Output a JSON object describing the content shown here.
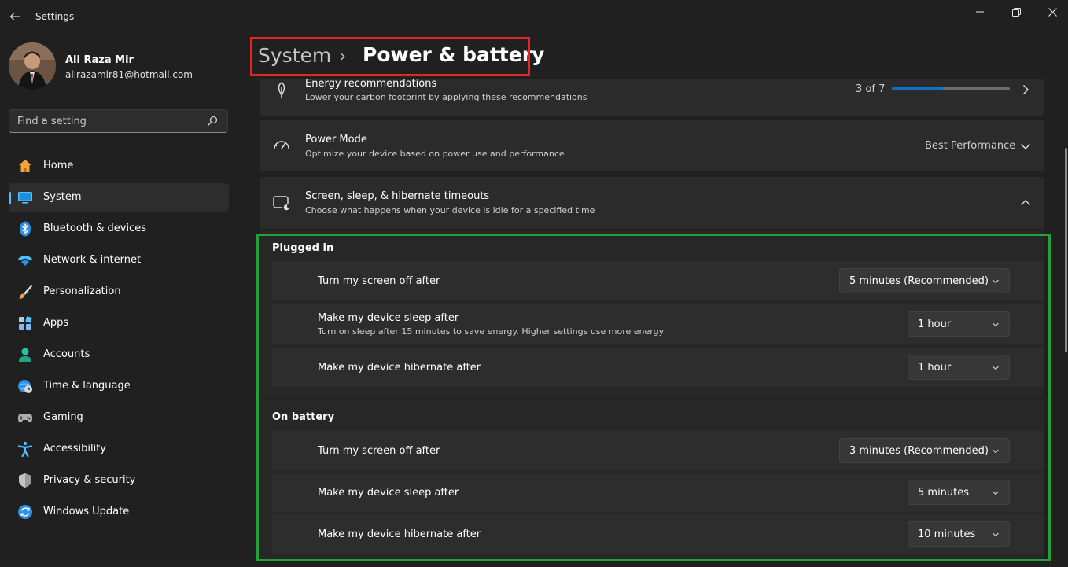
{
  "window": {
    "title": "Settings",
    "back_icon": "back-arrow-icon",
    "controls": [
      "minimize-icon",
      "maximize-icon",
      "close-icon"
    ]
  },
  "user": {
    "name": "Ali Raza Mir",
    "email": "alirazamir81@hotmail.com"
  },
  "search": {
    "placeholder": "Find a setting",
    "icon": "search-icon"
  },
  "nav": {
    "items": [
      {
        "label": "Home",
        "icon": "home-icon",
        "color": "#f3a33c"
      },
      {
        "label": "System",
        "icon": "monitor-icon",
        "color": "#4cc2ff",
        "active": true
      },
      {
        "label": "Bluetooth & devices",
        "icon": "bluetooth-icon",
        "color": "#2f8fe8"
      },
      {
        "label": "Network & internet",
        "icon": "wifi-icon",
        "color": "#4cc2ff"
      },
      {
        "label": "Personalization",
        "icon": "paintbrush-icon",
        "color": "#e8a05a"
      },
      {
        "label": "Apps",
        "icon": "apps-icon",
        "color": "#8ab4f8"
      },
      {
        "label": "Accounts",
        "icon": "person-icon",
        "color": "#27c4a3"
      },
      {
        "label": "Time & language",
        "icon": "globe-clock-icon",
        "color": "#4cc2ff"
      },
      {
        "label": "Gaming",
        "icon": "gamepad-icon",
        "color": "#b0b0b0"
      },
      {
        "label": "Accessibility",
        "icon": "accessibility-icon",
        "color": "#4cc2ff"
      },
      {
        "label": "Privacy & security",
        "icon": "shield-icon",
        "color": "#9a9a9a"
      },
      {
        "label": "Windows Update",
        "icon": "update-icon",
        "color": "#2f8fe8"
      }
    ]
  },
  "breadcrumb": {
    "parent": "System",
    "separator": "›",
    "current": "Power & battery"
  },
  "energy": {
    "title": "Energy recommendations",
    "desc": "Lower your carbon footprint by applying these recommendations",
    "count_text": "3 of 7",
    "progress": 0.43
  },
  "power_mode": {
    "title": "Power Mode",
    "desc": "Optimize your device based on power use and performance",
    "value": "Best Performance"
  },
  "timeouts": {
    "title": "Screen, sleep, & hibernate timeouts",
    "desc": "Choose what happens when your device is idle for a specified time",
    "plugged_in": {
      "label": "Plugged in",
      "rows": [
        {
          "title": "Turn my screen off after",
          "sub": "",
          "value": "5 minutes (Recommended)"
        },
        {
          "title": "Make my device sleep after",
          "sub": "Turn on sleep after 15 minutes to save energy. Higher settings use more energy",
          "value": "1 hour"
        },
        {
          "title": "Make my device hibernate after",
          "sub": "",
          "value": "1 hour"
        }
      ]
    },
    "on_battery": {
      "label": "On battery",
      "rows": [
        {
          "title": "Turn my screen off after",
          "sub": "",
          "value": "3 minutes (Recommended)"
        },
        {
          "title": "Make my device sleep after",
          "sub": "",
          "value": "5 minutes"
        },
        {
          "title": "Make my device hibernate after",
          "sub": "",
          "value": "10 minutes"
        }
      ]
    }
  },
  "colors": {
    "accent": "#4cc2ff",
    "highlight_red": "#e32526",
    "highlight_green": "#22a13a"
  }
}
